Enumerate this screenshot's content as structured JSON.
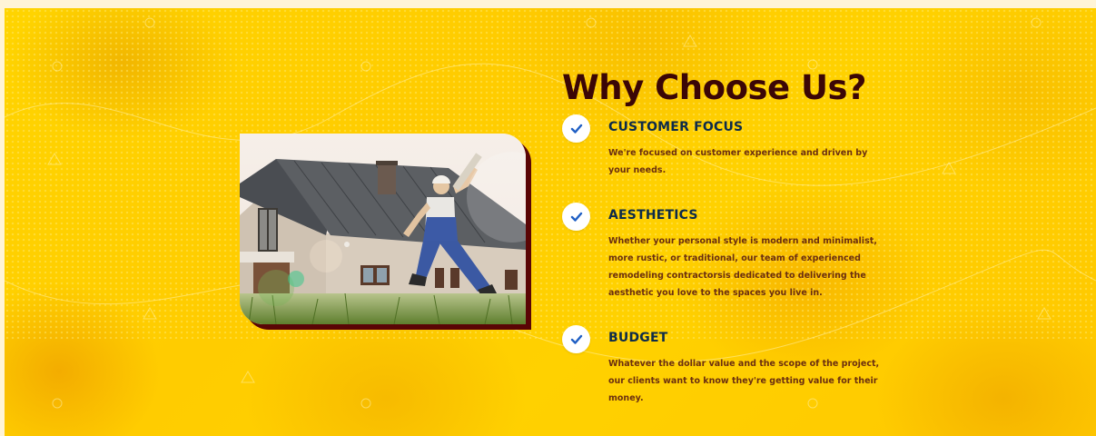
{
  "section": {
    "heading": "Why Choose Us?",
    "image": {
      "name": "house-photo",
      "depiction": "worker in overalls jumping in front of a house holding a roll of plans"
    },
    "features": [
      {
        "icon": "check-icon",
        "title": "CUSTOMER FOCUS",
        "text": "We're focused on customer experience and driven by your needs."
      },
      {
        "icon": "check-icon",
        "title": "AESTHETICS",
        "text": "Whether your personal style is modern and minimalist, more rustic, or traditional, our team of experienced remodeling contractorsis dedicated to delivering the aesthetic you love to the spaces you live in."
      },
      {
        "icon": "check-icon",
        "title": "BUDGET",
        "text": "Whatever the dollar value and the scope of the project, our clients want to know they're getting value for their money."
      }
    ]
  },
  "colors": {
    "background": "#ffd400",
    "heading": "#3b0606",
    "feature_title": "#0d2b4a",
    "feature_text": "#6b2f10",
    "check": "#1f5fc4",
    "photo_shadow": "#5a0505"
  }
}
